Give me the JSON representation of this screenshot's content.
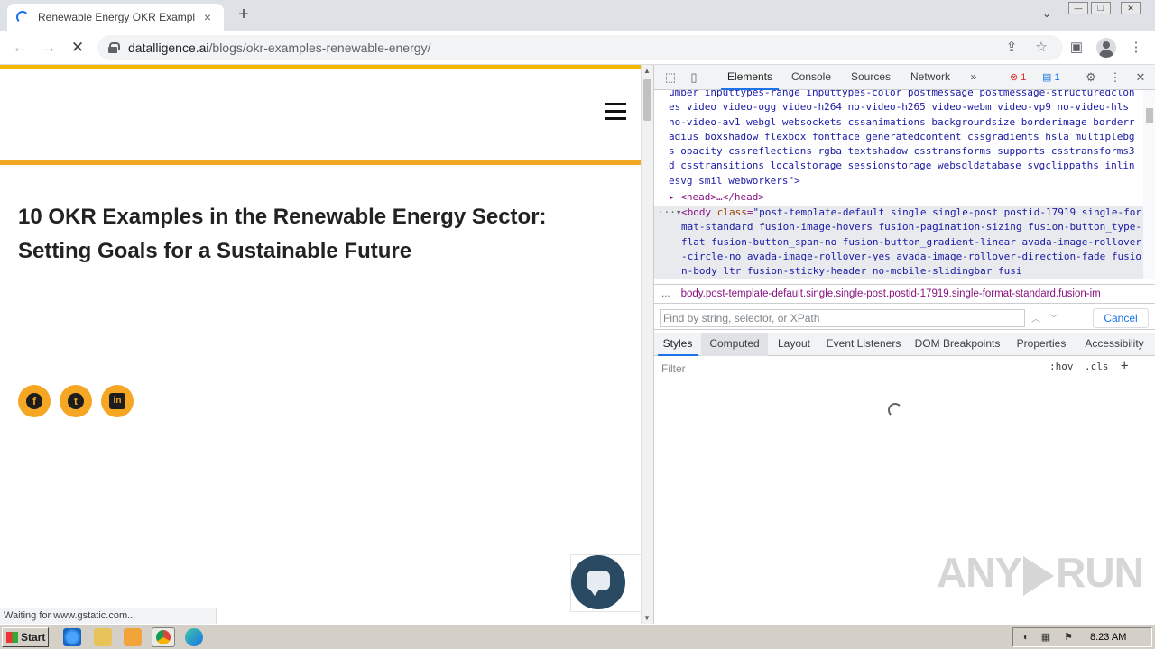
{
  "browser": {
    "tab_title": "Renewable Energy OKR Examples: D",
    "tab_close": "×",
    "new_tab": "+",
    "tab_list": "⌄",
    "window_controls": {
      "minimize": "—",
      "maximize": "❐",
      "close": "✕"
    },
    "nav": {
      "back": "←",
      "forward": "→",
      "reload": "✕"
    },
    "url_host": "datalligence.ai",
    "url_path": "/blogs/okr-examples-renewable-energy/",
    "toolbar_icons": [
      "share-icon",
      "star-icon",
      "sidepanel-icon",
      "avatar",
      "menu-icon"
    ],
    "status_text": "Waiting for www.gstatic.com..."
  },
  "page": {
    "article_title": "10 OKR Examples in the Renewable Energy Sector: Setting Goals for a Sustainable Future",
    "social": {
      "facebook": "f",
      "twitter": "t",
      "linkedin": "in"
    },
    "colors": {
      "accent": "#f5a623",
      "topbar": "#f5b800"
    }
  },
  "devtools": {
    "tabs": [
      "Elements",
      "Console",
      "Sources",
      "Network"
    ],
    "more_tabs": "»",
    "error_count": "1",
    "message_count": "1",
    "dom_text": "umber inputtypes-range inputtypes-color postmessage postmessage-structuredclones video video-ogg video-h264 no-video-h265 video-webm video-vp9 no-video-hls no-video-av1 webgl websockets cssanimations backgroundsize borderimage borderradius boxshadow flexbox fontface generatedcontent cssgradients hsla multiplebgs opacity cssreflections rgba textshadow csstransforms supports csstransforms3d csstransitions localstorage sessionstorage websqldatabase svgclippaths inlinesvg smil webworkers\">",
    "head_line": "<head>…</head>",
    "body_tag": "<body ",
    "body_attr": "class",
    "body_value": "\"post-template-default single single-post postid-17919 single-format-standard fusion-image-hovers fusion-pagination-sizing fusion-button_type-flat fusion-button_span-no fusion-button_gradient-linear avada-image-rollover-circle-no avada-image-rollover-yes avada-image-rollover-direction-fade fusion-body ltr fusion-sticky-header no-mobile-slidingbar fusi",
    "breadcrumb_dots": "...",
    "breadcrumb": "body.post-template-default.single.single-post.postid-17919.single-format-standard.fusion-im",
    "find_placeholder": "Find by string, selector, or XPath",
    "find_cancel": "Cancel",
    "sub_tabs": [
      "Styles",
      "Computed",
      "Layout",
      "Event Listeners",
      "DOM Breakpoints",
      "Properties",
      "Accessibility"
    ],
    "filter_placeholder": "Filter",
    "hov": ":hov",
    "cls": ".cls",
    "add_rule": "+"
  },
  "watermark": {
    "left": "ANY",
    "right": "RUN"
  },
  "taskbar": {
    "start_label": "Start",
    "clock": "8:23 AM",
    "apps": [
      "ie-icon",
      "explorer-icon",
      "media-icon",
      "chrome-icon",
      "edge-icon"
    ]
  }
}
